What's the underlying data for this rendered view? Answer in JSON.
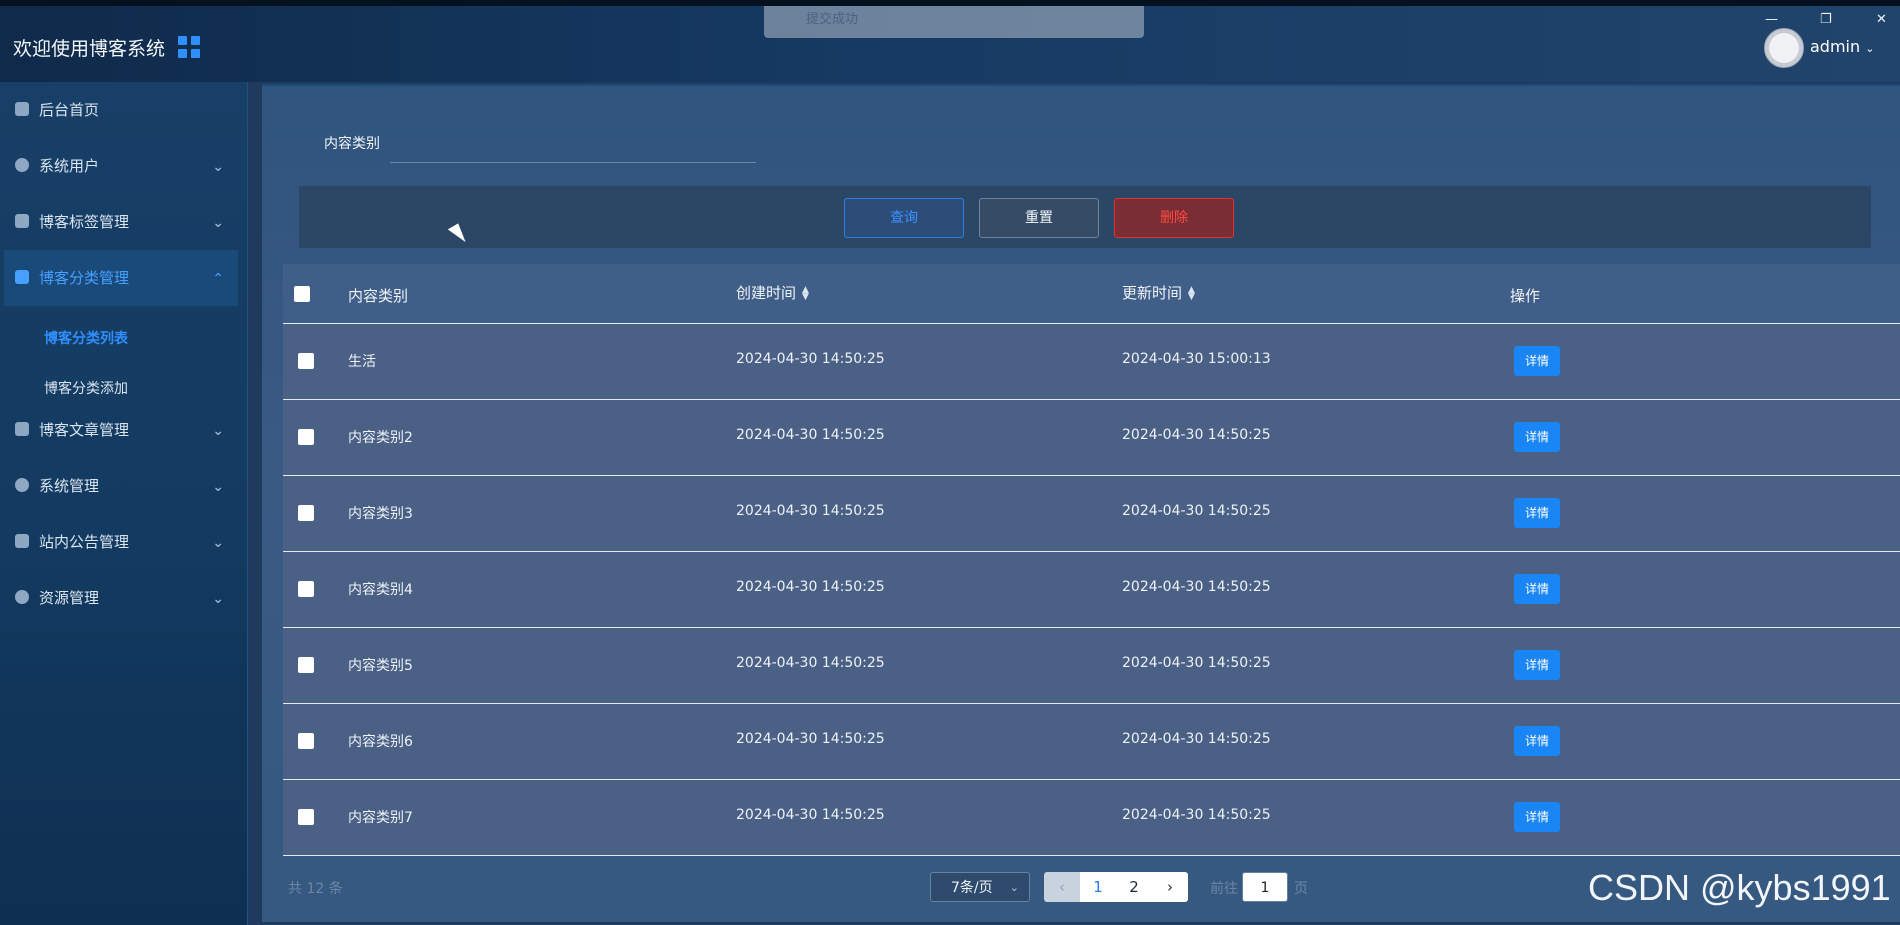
{
  "header": {
    "title": "欢迎使用博客系统",
    "toast_text": "提交成功",
    "user_name": "admin",
    "menu_icon": "grid-icon"
  },
  "sidebar": {
    "items": [
      {
        "label": "后台首页",
        "icon": "home-icon"
      },
      {
        "label": "系统用户",
        "icon": "user-icon"
      },
      {
        "label": "博客标签管理",
        "icon": "grid-icon"
      },
      {
        "label": "博客分类管理",
        "icon": "grid-icon"
      },
      {
        "label": "博客文章管理",
        "icon": "grid-icon"
      },
      {
        "label": "系统管理",
        "icon": "gear-icon"
      },
      {
        "label": "站内公告管理",
        "icon": "document-icon"
      },
      {
        "label": "资源管理",
        "icon": "pie-chart-icon"
      }
    ],
    "sub": {
      "list_label": "博客分类列表",
      "add_label": "博客分类添加"
    }
  },
  "filter": {
    "label": "内容类别",
    "value": ""
  },
  "actions": {
    "query": "查询",
    "reset": "重置",
    "delete": "删除"
  },
  "table": {
    "columns": [
      "内容类别",
      "创建时间",
      "更新时间",
      "操作"
    ],
    "detail_label": "详情",
    "rows": [
      {
        "category": "生活",
        "created": "2024-04-30 14:50:25",
        "updated": "2024-04-30 15:00:13"
      },
      {
        "category": "内容类别2",
        "created": "2024-04-30 14:50:25",
        "updated": "2024-04-30 14:50:25"
      },
      {
        "category": "内容类别3",
        "created": "2024-04-30 14:50:25",
        "updated": "2024-04-30 14:50:25"
      },
      {
        "category": "内容类别4",
        "created": "2024-04-30 14:50:25",
        "updated": "2024-04-30 14:50:25"
      },
      {
        "category": "内容类别5",
        "created": "2024-04-30 14:50:25",
        "updated": "2024-04-30 14:50:25"
      },
      {
        "category": "内容类别6",
        "created": "2024-04-30 14:50:25",
        "updated": "2024-04-30 14:50:25"
      },
      {
        "category": "内容类别7",
        "created": "2024-04-30 14:50:25",
        "updated": "2024-04-30 14:50:25"
      }
    ]
  },
  "pagination": {
    "total": "共 12 条",
    "page_size": "7条/页",
    "pages": [
      "1",
      "2"
    ],
    "goto_label": "前往",
    "goto_value": "1",
    "goto_unit": "页"
  },
  "watermark": "CSDN @kybs1991",
  "colors": {
    "accent": "#1a86f5",
    "danger": "#e0332b",
    "sidebar_active": "#46a0ff"
  }
}
